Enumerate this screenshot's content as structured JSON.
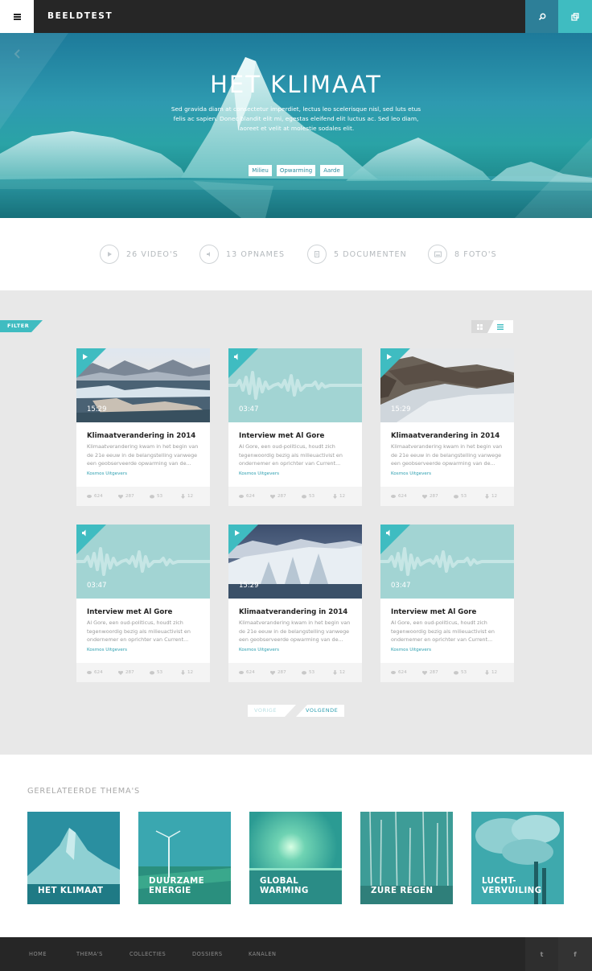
{
  "header": {
    "brand": "BEELDTEST",
    "menu_icon": "hamburger-icon",
    "search_icon": "search-icon",
    "share_icon": "external-link-icon",
    "accent_dark": "#2d7f98",
    "accent_light": "#3fbcc1"
  },
  "hero": {
    "title": "HET KLIMAAT",
    "description": "Sed gravida diam at consectetur imperdiet, lectus leo scelerisque nisl, sed luts etus felis ac sapien. Donec blandit elit mi, egestas eleifend elit luctus ac. Sed leo diam, laoreet et velit at molestie sodales elit.",
    "tags": [
      "Milieu",
      "Opwarming",
      "Aarde"
    ]
  },
  "stats": [
    {
      "label": "26 VIDEO'S",
      "icon": "play-icon"
    },
    {
      "label": "13 OPNAMES",
      "icon": "speaker-icon"
    },
    {
      "label": "5 DOCUMENTEN",
      "icon": "document-icon"
    },
    {
      "label": "8 FOTO'S",
      "icon": "photo-icon"
    }
  ],
  "filter": {
    "label": "FILTER"
  },
  "view_toggle": {
    "grid_icon": "grid-icon",
    "list_icon": "list-icon"
  },
  "cards": [
    {
      "type": "video",
      "duration": "15:29",
      "title": "Klimaatverandering in 2014",
      "description": "Klimaatverandering kwam in het begin van de 21e eeuw in de belangstelling vanwege een geobserveerde opwarming van de...",
      "publisher": "Kosmos Uitgevers",
      "views": "624",
      "likes": "287",
      "comments": "53",
      "downloads": "12",
      "image": "iceberg-lake"
    },
    {
      "type": "audio",
      "duration": "03:47",
      "title": "Interview met Al Gore",
      "description": "Al Gore, een oud-politicus, houdt zich tegenwoordig bezig als milieuactivist en ondernemer en oprichter van Current...",
      "publisher": "Kosmos Uitgevers",
      "views": "624",
      "likes": "287",
      "comments": "53",
      "downloads": "12",
      "image": "waveform"
    },
    {
      "type": "video",
      "duration": "15:29",
      "title": "Klimaatverandering in 2014",
      "description": "Klimaatverandering kwam in het begin van de 21e eeuw in de belangstelling vanwege een geobserveerde opwarming van de...",
      "publisher": "Kosmos Uitgevers",
      "views": "624",
      "likes": "287",
      "comments": "53",
      "downloads": "12",
      "image": "glacier-aerial"
    },
    {
      "type": "audio",
      "duration": "03:47",
      "title": "Interview met Al Gore",
      "description": "Al Gore, een oud-politicus, houdt zich tegenwoordig bezig als milieuactivist en ondernemer en oprichter van Current...",
      "publisher": "Kosmos Uitgevers",
      "views": "624",
      "likes": "287",
      "comments": "53",
      "downloads": "12",
      "image": "waveform"
    },
    {
      "type": "video",
      "duration": "15:29",
      "title": "Klimaatverandering in 2014",
      "description": "Klimaatverandering kwam in het begin van de 21e eeuw in de belangstelling vanwege een geobserveerde opwarming van de...",
      "publisher": "Kosmos Uitgevers",
      "views": "624",
      "likes": "287",
      "comments": "53",
      "downloads": "12",
      "image": "ice-cliff"
    },
    {
      "type": "audio",
      "duration": "03:47",
      "title": "Interview met Al Gore",
      "description": "Al Gore, een oud-politicus, houdt zich tegenwoordig bezig als milieuactivist en ondernemer en oprichter van Current...",
      "publisher": "Kosmos Uitgevers",
      "views": "624",
      "likes": "287",
      "comments": "53",
      "downloads": "12",
      "image": "waveform"
    }
  ],
  "pagination": {
    "prev": "VORIGE",
    "next": "VOLGENDE"
  },
  "related": {
    "title": "GERELATEERDE THEMA'S",
    "themes": [
      {
        "label": "HET KLIMAAT",
        "image": "iceberg"
      },
      {
        "label": "DUURZAME\nENERGIE",
        "image": "wind-turbine"
      },
      {
        "label": "GLOBAL\nWARMING",
        "image": "sun-haze"
      },
      {
        "label": "ZURE REGEN",
        "image": "dead-trees"
      },
      {
        "label": "LUCHT-\nVERVUILING",
        "image": "smoke-stacks"
      }
    ]
  },
  "footer": {
    "nav": [
      "HOME",
      "THEMA'S",
      "COLLECTIES",
      "DOSSIERS",
      "KANALEN"
    ],
    "twitter": "t",
    "facebook": "f"
  }
}
